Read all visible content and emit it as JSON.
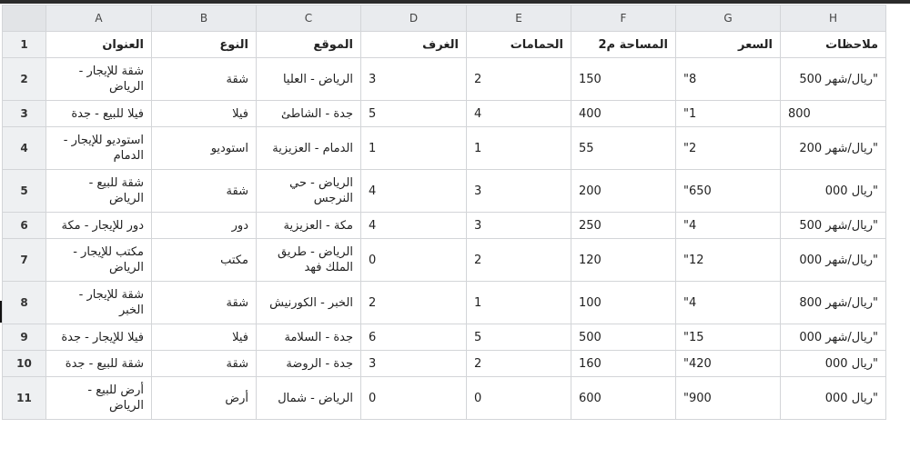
{
  "columns": [
    "A",
    "B",
    "C",
    "D",
    "E",
    "F",
    "G",
    "H"
  ],
  "rows": [
    {
      "n": "1",
      "cells": [
        "العنوان",
        "النوع",
        "الموقع",
        "الغرف",
        "الحمامات",
        "المساحة م2",
        "السعر",
        "ملاحظات"
      ]
    },
    {
      "n": "2",
      "cells": [
        "شقة للإيجار - الرياض",
        "شقة",
        "الرياض - العليا",
        "3",
        "2",
        "150",
        "\"8",
        "\"ريال/شهر 500"
      ]
    },
    {
      "n": "3",
      "cells": [
        "فيلا للبيع - جدة",
        "فيلا",
        "جدة - الشاطئ",
        "5",
        "4",
        "400",
        "\"1",
        "800"
      ]
    },
    {
      "n": "4",
      "cells": [
        "استوديو للإيجار - الدمام",
        "استوديو",
        "الدمام - العزيزية",
        "1",
        "1",
        "55",
        "\"2",
        "\"ريال/شهر 200"
      ]
    },
    {
      "n": "5",
      "cells": [
        "شقة للبيع - الرياض",
        "شقة",
        "الرياض - حي النرجس",
        "4",
        "3",
        "200",
        "\"650",
        "\"ريال 000"
      ]
    },
    {
      "n": "6",
      "cells": [
        "دور للإيجار - مكة",
        "دور",
        "مكة - العزيزية",
        "4",
        "3",
        "250",
        "\"4",
        "\"ريال/شهر 500"
      ]
    },
    {
      "n": "7",
      "cells": [
        "مكتب للإيجار - الرياض",
        "مكتب",
        "الرياض - طريق الملك فهد",
        "0",
        "2",
        "120",
        "\"12",
        "\"ريال/شهر 000"
      ]
    },
    {
      "n": "8",
      "cells": [
        "شقة للإيجار - الخبر",
        "شقة",
        "الخبر - الكورنيش",
        "2",
        "1",
        "100",
        "\"4",
        "\"ريال/شهر 800"
      ]
    },
    {
      "n": "9",
      "cells": [
        "فيلا للإيجار - جدة",
        "فيلا",
        "جدة - السلامة",
        "6",
        "5",
        "500",
        "\"15",
        "\"ريال/شهر 000"
      ]
    },
    {
      "n": "10",
      "cells": [
        "شقة للبيع - جدة",
        "شقة",
        "جدة - الروضة",
        "3",
        "2",
        "160",
        "\"420",
        "\"ريال 000"
      ]
    },
    {
      "n": "11",
      "cells": [
        "أرض للبيع - الرياض",
        "أرض",
        "الرياض - شمال",
        "0",
        "0",
        "600",
        "\"900",
        "\"ريال 000"
      ]
    }
  ]
}
